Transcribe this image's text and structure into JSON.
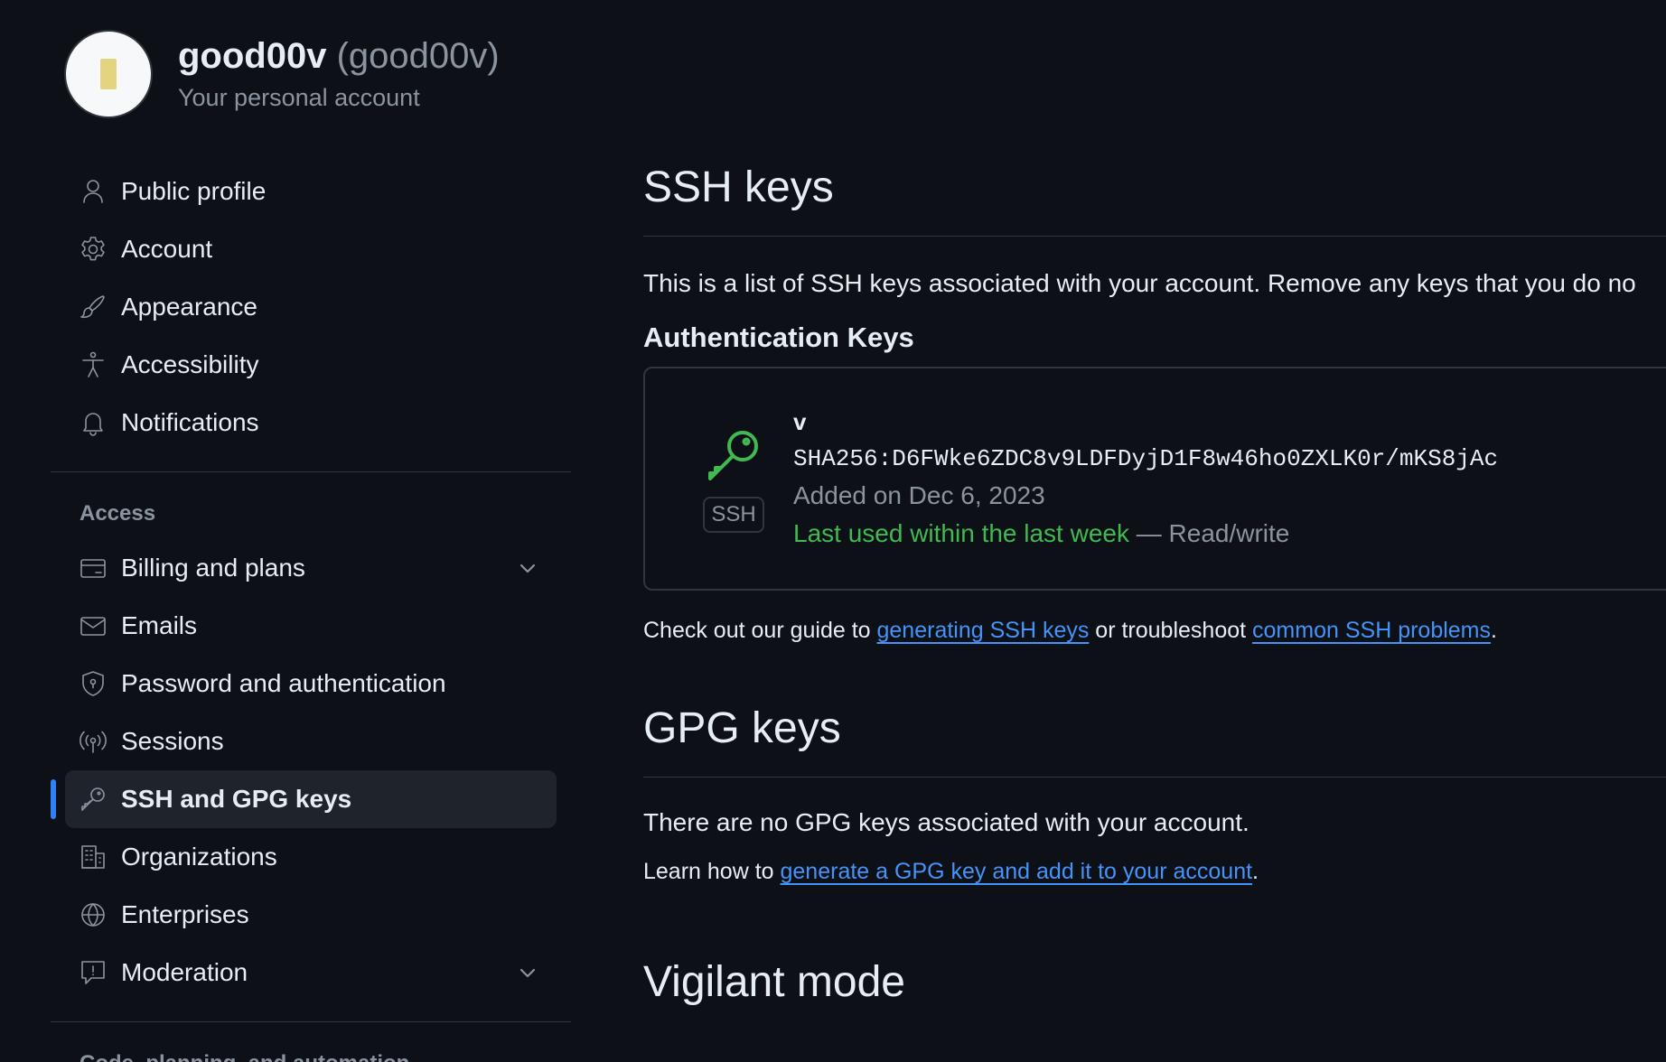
{
  "account": {
    "name": "good00v",
    "login": "(good00v)",
    "subtitle": "Your personal account"
  },
  "sidebar": {
    "top_items": [
      {
        "label": "Public profile",
        "icon": "person-icon"
      },
      {
        "label": "Account",
        "icon": "gear-icon"
      },
      {
        "label": "Appearance",
        "icon": "paintbrush-icon"
      },
      {
        "label": "Accessibility",
        "icon": "accessibility-icon"
      },
      {
        "label": "Notifications",
        "icon": "bell-icon"
      }
    ],
    "access_heading": "Access",
    "access_items": [
      {
        "label": "Billing and plans",
        "icon": "credit-card-icon",
        "expandable": true
      },
      {
        "label": "Emails",
        "icon": "mail-icon"
      },
      {
        "label": "Password and authentication",
        "icon": "shield-lock-icon"
      },
      {
        "label": "Sessions",
        "icon": "broadcast-icon"
      },
      {
        "label": "SSH and GPG keys",
        "icon": "key-icon",
        "active": true
      },
      {
        "label": "Organizations",
        "icon": "organization-icon"
      },
      {
        "label": "Enterprises",
        "icon": "globe-icon"
      },
      {
        "label": "Moderation",
        "icon": "report-icon",
        "expandable": true
      }
    ],
    "next_heading": "Code, planning, and automation"
  },
  "ssh": {
    "title": "SSH keys",
    "description": "This is a list of SSH keys associated with your account. Remove any keys that you do no",
    "auth_heading": "Authentication Keys",
    "key": {
      "badge": "SSH",
      "title": "v",
      "fingerprint": "SHA256:D6FWke6ZDC8v9LDFDyjD1F8w46ho0ZXLK0r/mKS8jAc",
      "added": "Added on Dec 6, 2023",
      "last_used": "Last used within the last week",
      "access": "— Read/write"
    },
    "guide_prefix": "Check out our guide to ",
    "guide_link1": "generating SSH keys",
    "guide_middle": " or troubleshoot ",
    "guide_link2": "common SSH problems",
    "guide_suffix": "."
  },
  "gpg": {
    "title": "GPG keys",
    "empty_text": "There are no GPG keys associated with your account.",
    "learn_prefix": "Learn how to ",
    "learn_link": "generate a GPG key and add it to your account",
    "learn_suffix": "."
  },
  "vigilant": {
    "title": "Vigilant mode"
  },
  "colors": {
    "background": "#0d1117",
    "accent": "#2f81f7",
    "link": "#4493f8",
    "success": "#3fb950",
    "muted": "#8b949e"
  }
}
